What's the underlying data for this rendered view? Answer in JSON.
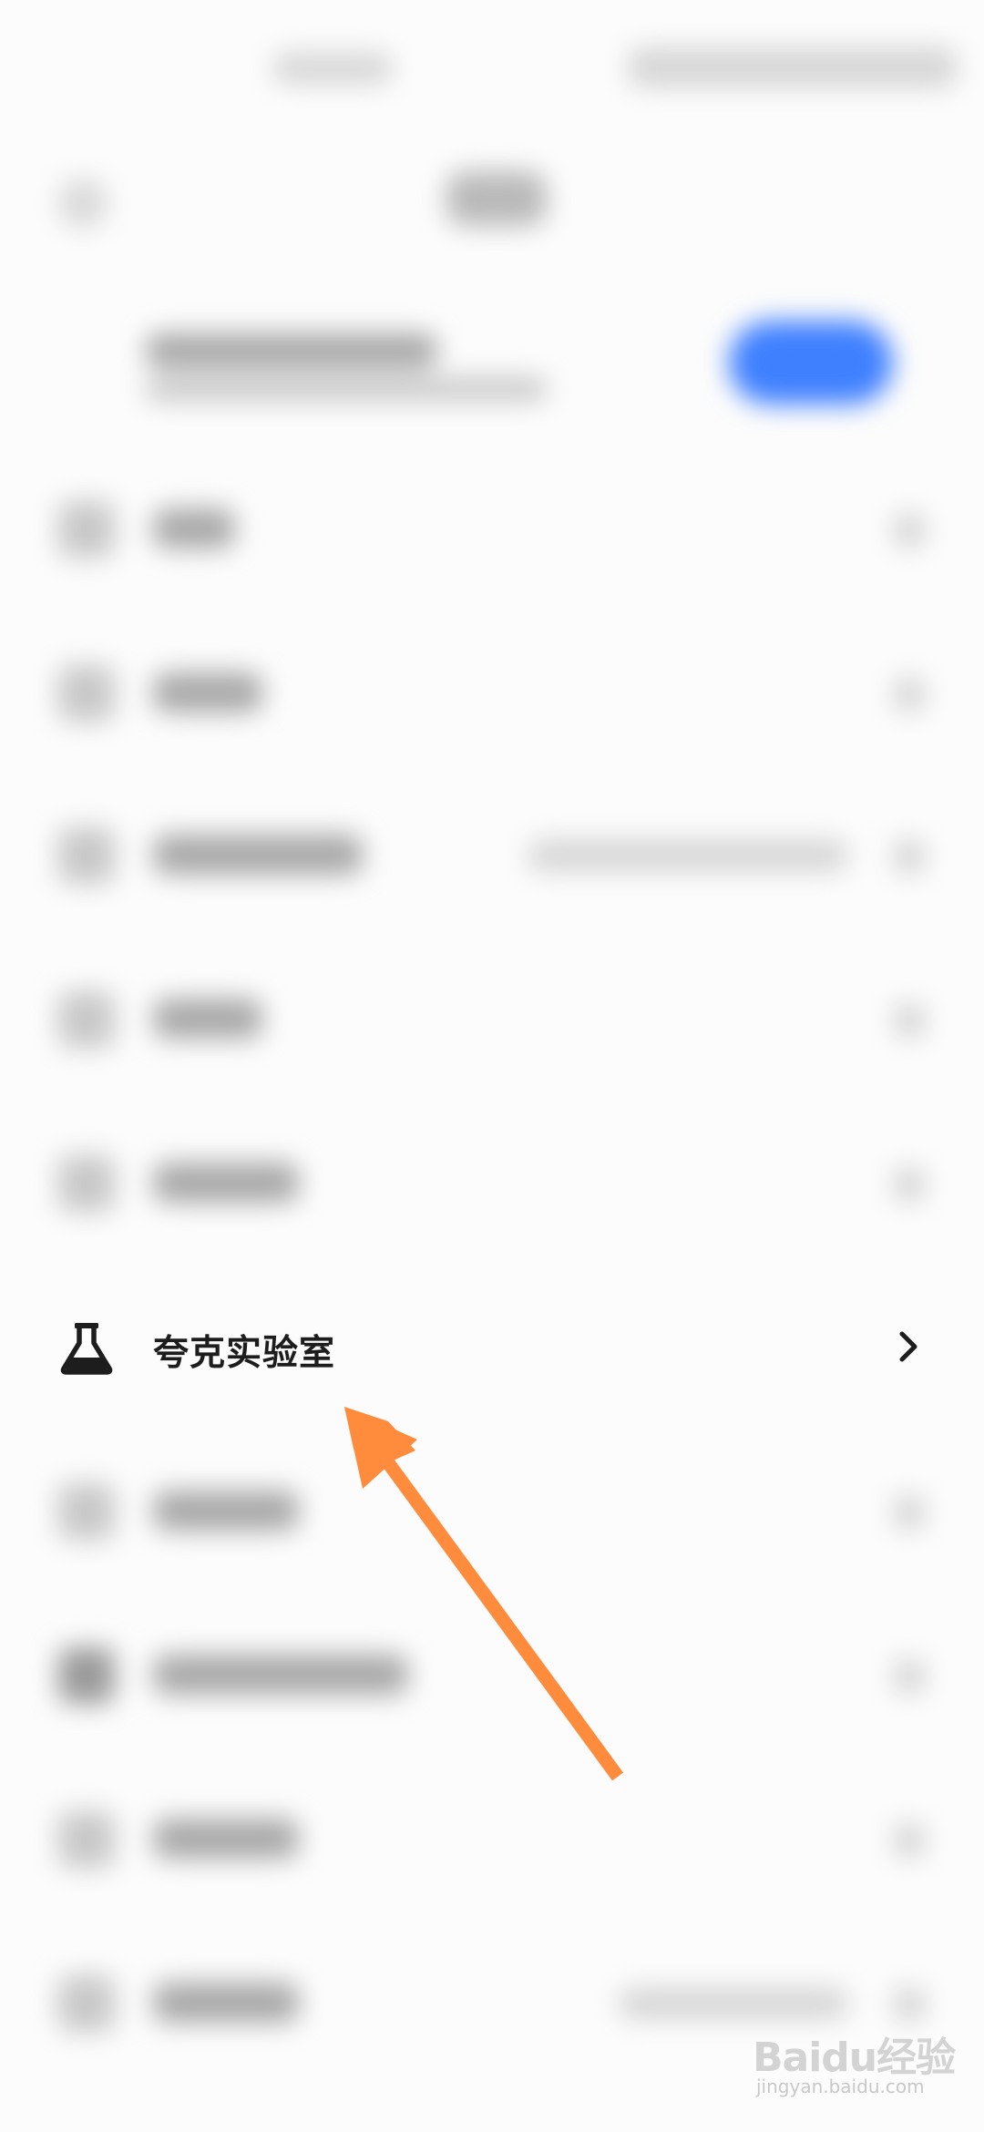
{
  "lab_item": {
    "label": "夸克实验室",
    "icon": "flask-icon",
    "chevron": "chevron-right-icon"
  },
  "annotation": {
    "arrow_color": "#ff8c3c",
    "arrow_icon": "arrow-pointer-icon"
  },
  "watermark": {
    "brand": "Baidu经验",
    "domain": "jingyan.baidu.com",
    "color": "#d3d3d3"
  },
  "colors": {
    "accent_button": "#3f80ff",
    "background": "#fcfcfc",
    "text": "#1d1d1d"
  }
}
